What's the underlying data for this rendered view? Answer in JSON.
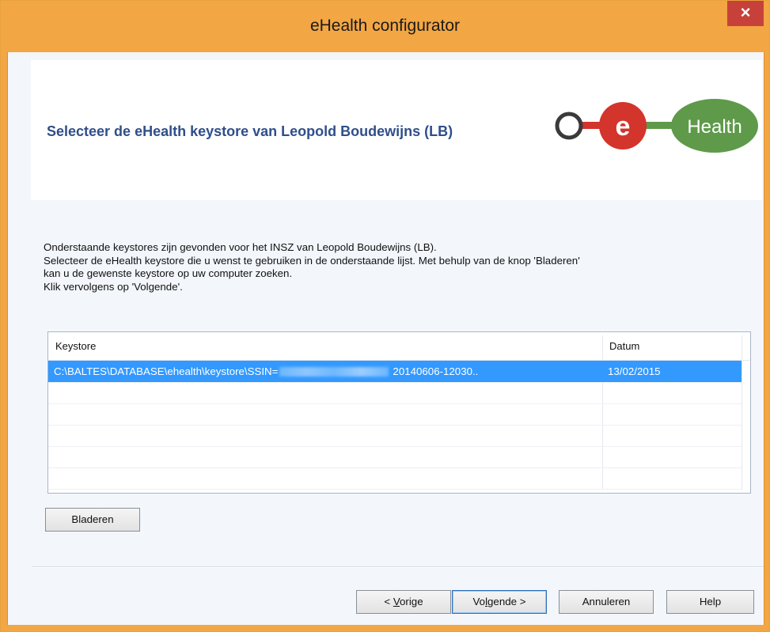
{
  "window": {
    "title": "eHealth configurator",
    "close_label": "×"
  },
  "header": {
    "title": "Selecteer de eHealth keystore van Leopold Boudewijns (LB)",
    "logo": {
      "letter": "e",
      "word": "Health",
      "icon": "ehealth-logo"
    }
  },
  "instructions": [
    "Onderstaande keystores zijn gevonden voor het INSZ van Leopold Boudewijns (LB).",
    "Selecteer de eHealth keystore die u wenst te gebruiken in de onderstaande lijst. Met behulp van de knop 'Bladeren'",
    "kan u de gewenste keystore op uw computer zoeken.",
    "Klik vervolgens op 'Volgende'."
  ],
  "list": {
    "columns": [
      "Keystore",
      "Datum"
    ],
    "rows": [
      {
        "keystore_prefix": "C:\\BALTES\\DATABASE\\ehealth\\keystore\\SSIN=",
        "keystore_suffix": "20140606-12030..",
        "datum": "13/02/2015",
        "selected": true
      }
    ]
  },
  "buttons": {
    "browse": "Bladeren",
    "prev_prefix": "< ",
    "prev_key": "V",
    "prev_rest": "orige",
    "next_prefix": "Vo",
    "next_key": "l",
    "next_rest": "gende >",
    "cancel": "Annuleren",
    "help": "Help"
  },
  "colors": {
    "title_bar": "#f2a644",
    "close_button": "#c7413a",
    "header_title": "#2f4e8a",
    "selection": "#3399ff",
    "logo_green": "#5e9a4a",
    "logo_red": "#d3342c"
  }
}
